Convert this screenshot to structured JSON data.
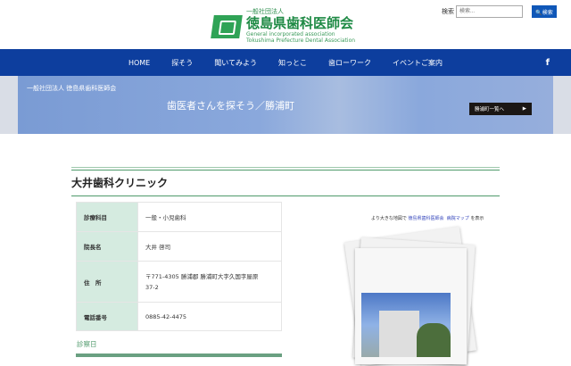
{
  "header": {
    "org_prefix": "一般社団法人",
    "org_name": "徳島県歯科医師会",
    "org_en1": "General incorporated association",
    "org_en2": "Tokushima Prefecture Dental Association",
    "search_label": "検索",
    "search_placeholder": "検索...",
    "search_button": "検索"
  },
  "nav": {
    "items": [
      "HOME",
      "探そう",
      "聞いてみよう",
      "知っとこ",
      "歯ローワーク",
      "イベントご案内"
    ],
    "facebook": "f"
  },
  "banner": {
    "logo_text": "一般社団法人 徳島県歯科医師会",
    "title": "歯医者さんを探そう／勝浦町",
    "button": "勝浦町一覧へ"
  },
  "clinic": {
    "name": "大井歯科クリニック",
    "rows": [
      {
        "label": "診療科目",
        "value": "一般・小児歯科"
      },
      {
        "label": "院長名",
        "value": "大井 啓司"
      },
      {
        "label": "住　所",
        "value": "〒771-4305 勝浦郡 勝浦町大字久国字屋原",
        "value2": "37-2"
      },
      {
        "label": "電話番号",
        "value": "0885-42-4475"
      }
    ],
    "section": "診察日"
  },
  "map": {
    "caption_pre": "より大きな地図で",
    "caption_link1": "徳島県歯科医師会",
    "caption_link2": "病院マップ",
    "caption_post": "を表示"
  }
}
